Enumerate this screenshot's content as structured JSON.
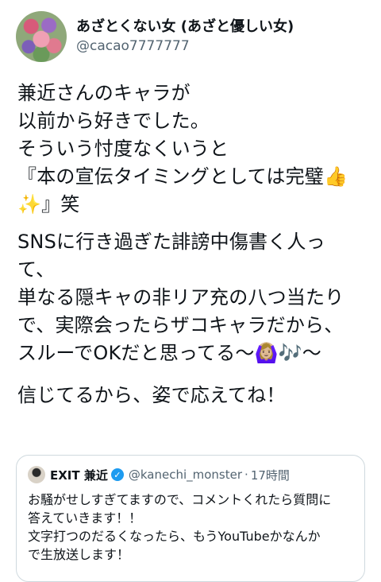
{
  "tweet": {
    "author": {
      "display_name": "あざとくない女 (あざと優しい女)",
      "handle": "@cacao7777777",
      "avatar_icon": "flower-bouquet-avatar"
    },
    "paragraphs": [
      "兼近さんのキャラが\n以前から好きでした。\nそういう忖度なくいうと\n『本の宣伝タイミングとしては完璧👍\n✨』笑",
      "SNSに行き過ぎた誹謗中傷書く人っ\nて、\n単なる隠キャの非リア充の八つ当たり\nで、実際会ったらザコキャラだから、\nスルーでOKだと思ってる〜🙆🏼‍♀️🎶〜",
      "信じてるから、姿で応えてね！"
    ]
  },
  "quoted_tweet": {
    "display_name": "EXIT 兼近",
    "verified_icon": "verified-badge-icon",
    "handle": "@kanechi_monster",
    "separator": "·",
    "time": "17時間",
    "text": "お騒がせしすぎてますので、コメントくれたら質問に\n答えていきます！！\n文字打つのだるくなったら、もうYouTubeかなんか\nで生放送します！",
    "accent_color": "#1d9bf0"
  }
}
